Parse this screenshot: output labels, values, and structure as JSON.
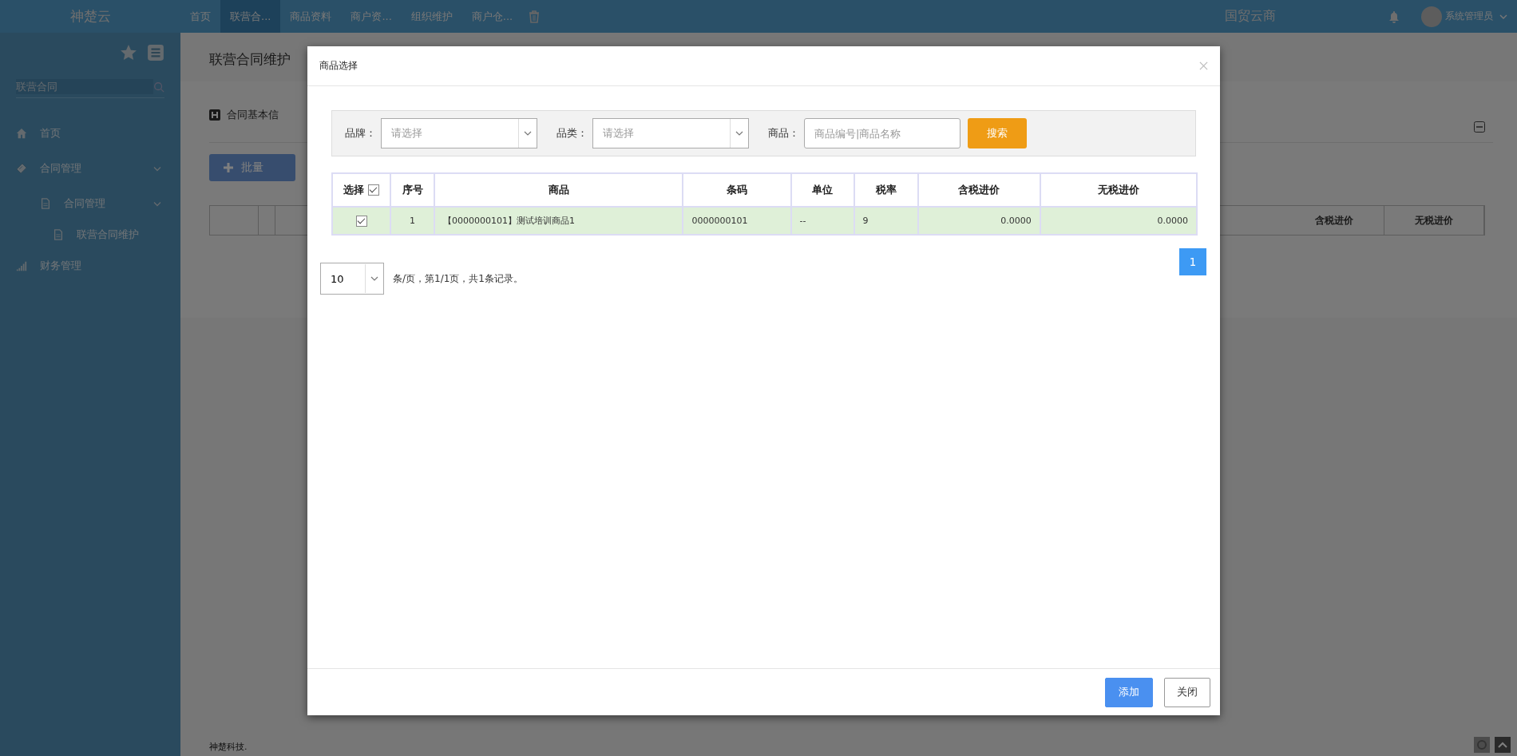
{
  "top_bar": {
    "logo": "神楚云",
    "nav": [
      {
        "label": "首页",
        "selected": false
      },
      {
        "label": "联营合...",
        "selected": true
      },
      {
        "label": "商品资料",
        "selected": false
      },
      {
        "label": "商户资...",
        "selected": false
      },
      {
        "label": "组织维护",
        "selected": false
      },
      {
        "label": "商户仓...",
        "selected": false
      }
    ],
    "brand": "国贸云商",
    "user": "系统管理员"
  },
  "sidebar": {
    "search": {
      "value": "联营合同"
    },
    "items": [
      {
        "label": "首页",
        "kind": "home"
      },
      {
        "label": "合同管理",
        "kind": "tag",
        "expanded": true,
        "children": [
          {
            "label": "合同管理",
            "kind": "doc",
            "expanded": true,
            "children": [
              {
                "label": "联营合同维护",
                "kind": "doc"
              }
            ]
          }
        ]
      },
      {
        "label": "财务管理",
        "kind": "signal"
      }
    ]
  },
  "page": {
    "title": "联营合同维护",
    "tab": "合同基本信",
    "batch_button": "批量",
    "table_columns": [
      "含税进价",
      "无税进价"
    ],
    "footer": "神楚科技."
  },
  "dialog": {
    "title": "商品选择",
    "filters": [
      {
        "label": "品牌：",
        "kind": "select",
        "placeholder": "请选择"
      },
      {
        "label": "品类：",
        "kind": "select",
        "placeholder": "请选择"
      },
      {
        "label": "商品：",
        "kind": "input",
        "placeholder": "商品编号|商品名称"
      }
    ],
    "search_button": "搜索",
    "table": {
      "select_all": {
        "label": "选择",
        "checked": true
      },
      "columns": [
        "序号",
        "商品",
        "条码",
        "单位",
        "税率",
        "含税进价",
        "无税进价"
      ],
      "rows": [
        {
          "selected": true,
          "cells": [
            "1",
            "【0000000101】测试培训商品1",
            "0000000101",
            "--",
            "9",
            "0.0000",
            "0.0000"
          ]
        }
      ]
    },
    "pagination": {
      "page_size": "10",
      "summary": "条/页，第1/1页，共1条记录。",
      "pages": [
        {
          "label": "1",
          "selected": true
        }
      ]
    },
    "buttons": [
      {
        "label": "添加",
        "kind": "primary"
      },
      {
        "label": "关闭",
        "kind": "default"
      }
    ]
  }
}
